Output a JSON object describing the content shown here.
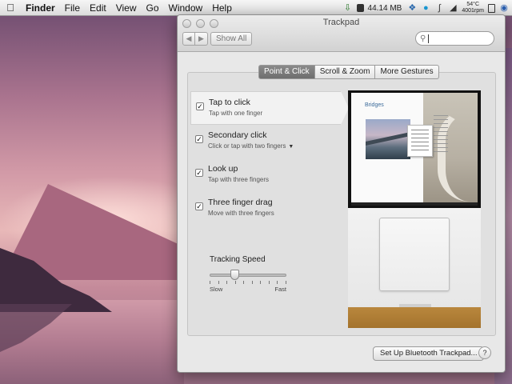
{
  "menubar": {
    "apple_icon": "apple-icon",
    "items": [
      "Finder",
      "File",
      "Edit",
      "View",
      "Go",
      "Window",
      "Help"
    ],
    "status": {
      "memory": "44.14 MB",
      "temperature": "54°C",
      "rpm": "4001rpm",
      "icons": [
        "download-icon",
        "memory-icon",
        "dropbox-icon",
        "skype-icon",
        "bluetooth-icon",
        "wifi-icon",
        "temperature-icon",
        "battery-icon",
        "spotlight-icon"
      ]
    }
  },
  "window": {
    "title": "Trackpad",
    "show_all": "Show All",
    "search": {
      "placeholder": "",
      "value": ""
    },
    "tabs": [
      {
        "label": "Point & Click",
        "active": true
      },
      {
        "label": "Scroll & Zoom",
        "active": false
      },
      {
        "label": "More Gestures",
        "active": false
      }
    ],
    "options": [
      {
        "title": "Tap to click",
        "subtitle": "Tap with one finger",
        "checked": true,
        "selected": true,
        "has_dropdown": false
      },
      {
        "title": "Secondary click",
        "subtitle": "Click or tap with two fingers",
        "checked": true,
        "selected": false,
        "has_dropdown": true
      },
      {
        "title": "Look up",
        "subtitle": "Tap with three fingers",
        "checked": true,
        "selected": false,
        "has_dropdown": false
      },
      {
        "title": "Three finger drag",
        "subtitle": "Move with three fingers",
        "checked": true,
        "selected": false,
        "has_dropdown": false
      }
    ],
    "tracking": {
      "label": "Tracking Speed",
      "min_label": "Slow",
      "max_label": "Fast",
      "value": 0.3
    },
    "preview": {
      "doc_title": "Bridges"
    },
    "setup_button": "Set Up Bluetooth Trackpad...",
    "help_button": "?"
  }
}
